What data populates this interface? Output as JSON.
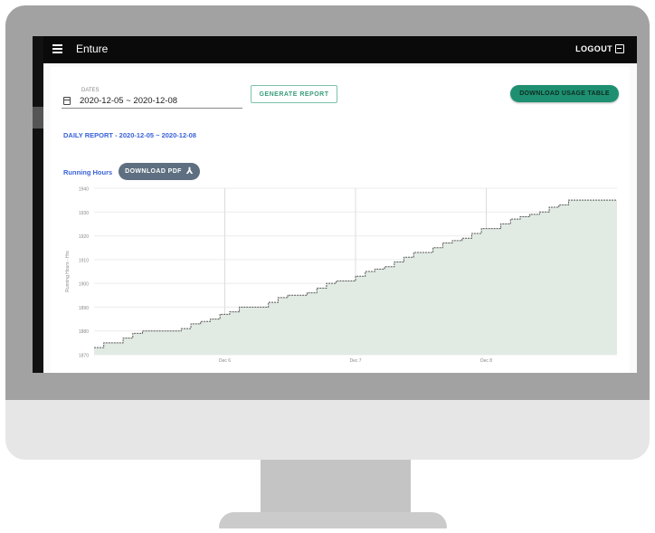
{
  "app": {
    "title": "Enture",
    "logout_label": "LOGOUT"
  },
  "report_form": {
    "dates_label": "DATES",
    "dates_value": "2020-12-05 ~ 2020-12-08",
    "generate_label": "GENERATE REPORT",
    "download_table_label": "DOWNLOAD USAGE TABLE"
  },
  "report": {
    "heading": "DAILY REPORT - 2020-12-05 ~ 2020-12-08",
    "section_label": "Running Hours",
    "download_pdf_label": "DOWNLOAD PDF"
  },
  "colors": {
    "primary": "#1e9071",
    "link": "#3a62d9",
    "pdf_button": "#5d6f80",
    "area_fill": "#e1ebe4",
    "line": "#555555"
  },
  "icons": {
    "menu": "menu-icon",
    "logout": "logout-icon",
    "calendar": "calendar-icon",
    "pdf": "pdf-icon"
  },
  "chart_data": {
    "type": "area",
    "ylabel": "Running Hours - Hrs",
    "ylim": [
      1870,
      1940
    ],
    "yticks": [
      1870,
      1880,
      1890,
      1900,
      1910,
      1920,
      1930,
      1940
    ],
    "xticks": [
      "Dec 6",
      "Dec 7",
      "Dec 8"
    ],
    "grid": true,
    "series": [
      {
        "values": [
          1873,
          1875,
          1875,
          1877,
          1879,
          1880,
          1880,
          1880,
          1880,
          1881,
          1883,
          1884,
          1885,
          1887,
          1888,
          1890,
          1890,
          1890,
          1892,
          1894,
          1895,
          1895,
          1896,
          1898,
          1900,
          1901,
          1901,
          1903,
          1905,
          1906,
          1907,
          1909,
          1911,
          1913,
          1913,
          1915,
          1917,
          1918,
          1919,
          1921,
          1923,
          1923,
          1925,
          1927,
          1928,
          1929,
          1930,
          1932,
          1933,
          1935,
          1935,
          1935,
          1935,
          1935,
          1935
        ]
      }
    ]
  }
}
